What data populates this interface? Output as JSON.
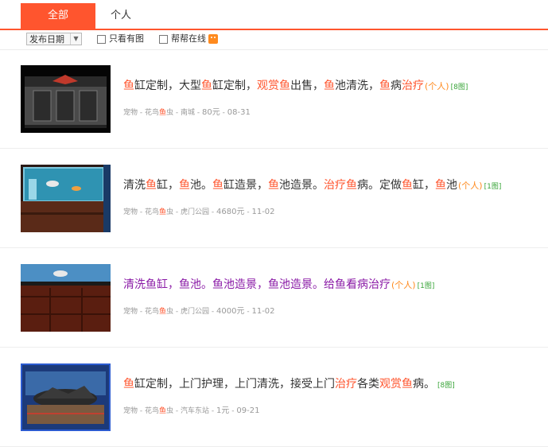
{
  "tabs": {
    "all": "全部",
    "personal": "个人"
  },
  "filters": {
    "sort_select": "发布日期",
    "only_pic": "只看有图",
    "bangbang": "帮帮在线"
  },
  "listings": [
    {
      "title": [
        {
          "t": "鱼",
          "h": true
        },
        {
          "t": "缸定制，大型",
          "h": false
        },
        {
          "t": "鱼",
          "h": true
        },
        {
          "t": "缸定制，",
          "h": false
        },
        {
          "t": "观赏鱼",
          "h": true
        },
        {
          "t": "出售，",
          "h": false
        },
        {
          "t": "鱼",
          "h": true
        },
        {
          "t": "池清洗，",
          "h": false
        },
        {
          "t": "鱼",
          "h": true
        },
        {
          "t": "病",
          "h": false
        },
        {
          "t": "治疗",
          "h": true
        }
      ],
      "tag": "(个人)",
      "pics": "[8图]",
      "meta": {
        "cat1": "宠物",
        "cat2a": "花鸟",
        "cat2b": "鱼",
        "cat2c": "虫",
        "area": "南城",
        "price": "80元",
        "date": "08-31"
      }
    },
    {
      "title": [
        {
          "t": "清洗",
          "h": false
        },
        {
          "t": "鱼",
          "h": true
        },
        {
          "t": "缸，",
          "h": false
        },
        {
          "t": "鱼",
          "h": true
        },
        {
          "t": "池。",
          "h": false
        },
        {
          "t": "鱼",
          "h": true
        },
        {
          "t": "缸造景，",
          "h": false
        },
        {
          "t": "鱼",
          "h": true
        },
        {
          "t": "池造景。",
          "h": false
        },
        {
          "t": "治疗鱼",
          "h": true
        },
        {
          "t": "病。定做",
          "h": false
        },
        {
          "t": "鱼",
          "h": true
        },
        {
          "t": "缸，",
          "h": false
        },
        {
          "t": "鱼",
          "h": true
        },
        {
          "t": "池",
          "h": false
        }
      ],
      "tag": "(个人)",
      "pics": "[1图]",
      "meta": {
        "cat1": "宠物",
        "cat2a": "花鸟",
        "cat2b": "鱼",
        "cat2c": "虫",
        "area": "虎门公园",
        "price": "4680元",
        "date": "11-02"
      }
    },
    {
      "title": [
        {
          "t": "清洗鱼缸，鱼池。鱼池造景，鱼池造景。给鱼看病治疗",
          "h": false
        }
      ],
      "tag": "(个人)",
      "pics": "[1图]",
      "meta": {
        "cat1": "宠物",
        "cat2a": "花鸟",
        "cat2b": "鱼",
        "cat2c": "虫",
        "area": "虎门公园",
        "price": "4000元",
        "date": "11-02"
      }
    },
    {
      "title": [
        {
          "t": "鱼",
          "h": true
        },
        {
          "t": "缸定制，上门护理，上门清洗，接受上门",
          "h": false
        },
        {
          "t": "治疗",
          "h": true
        },
        {
          "t": "各类",
          "h": false
        },
        {
          "t": "观赏鱼",
          "h": true
        },
        {
          "t": "病。",
          "h": false
        }
      ],
      "tag": "",
      "pics": "[8图]",
      "meta": {
        "cat1": "宠物",
        "cat2a": "花鸟",
        "cat2b": "鱼",
        "cat2c": "虫",
        "area": "汽车东站",
        "price": "1元",
        "date": "09-21"
      }
    }
  ],
  "colors": {
    "accent": "#ff552e",
    "visited": "#8a1aa6",
    "tag": "#ff8a1e",
    "pics": "#3aa53a"
  }
}
